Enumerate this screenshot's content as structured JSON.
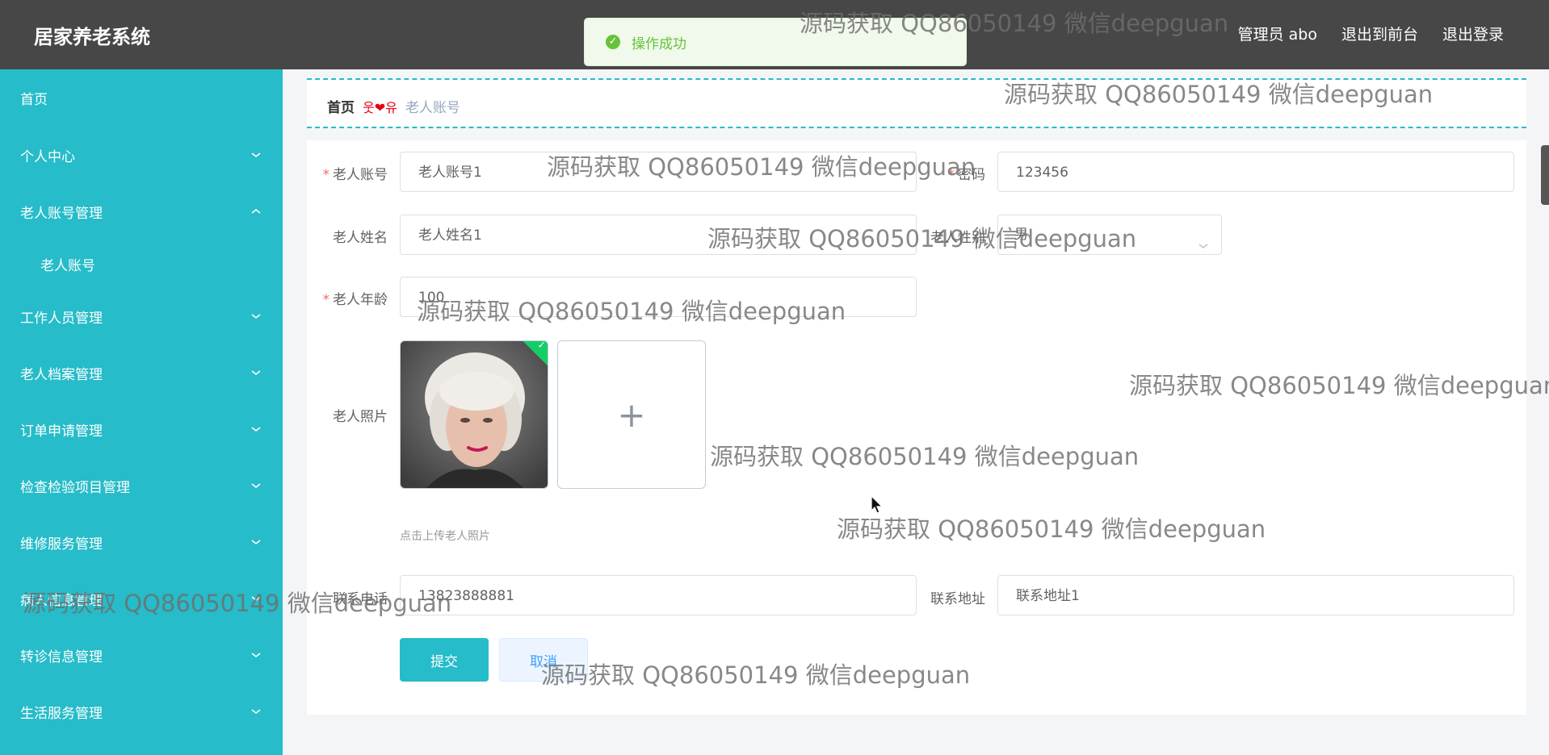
{
  "app": {
    "title": "居家养老系统"
  },
  "header": {
    "admin_label": "管理员 abo",
    "to_front": "退出到前台",
    "logout": "退出登录"
  },
  "toast": {
    "message": "操作成功"
  },
  "sidebar": {
    "items": [
      {
        "label": "首页"
      },
      {
        "label": "个人中心"
      },
      {
        "label": "老人账号管理"
      },
      {
        "label": "老人账号"
      },
      {
        "label": "工作人员管理"
      },
      {
        "label": "老人档案管理"
      },
      {
        "label": "订单申请管理"
      },
      {
        "label": "检查检验项目管理"
      },
      {
        "label": "维修服务管理"
      },
      {
        "label": "病人信息管理"
      },
      {
        "label": "转诊信息管理"
      },
      {
        "label": "生活服务管理"
      }
    ]
  },
  "breadcrumb": {
    "home": "首页",
    "separator": "웃❤유",
    "current": "老人账号"
  },
  "form": {
    "account_label": "老人账号",
    "account_value": "老人账号1",
    "password_label": "密码",
    "password_value": "123456",
    "name_label": "老人姓名",
    "name_value": "老人姓名1",
    "gender_label": "老人性别",
    "gender_value": "男",
    "age_label": "老人年龄",
    "age_value": "100",
    "photo_label": "老人照片",
    "upload_plus": "+",
    "photo_hint": "点击上传老人照片",
    "phone_label": "联系电话",
    "phone_value": "13823888881",
    "address_label": "联系地址",
    "address_value": "联系地址1",
    "submit": "提交",
    "cancel": "取消"
  },
  "watermark": {
    "text": "源码获取 QQ86050149 微信deepguan"
  },
  "colors": {
    "sidebar": "#26bcc9",
    "topbar": "#474747",
    "accent": "#26bcc9",
    "required": "#f56c6c"
  }
}
